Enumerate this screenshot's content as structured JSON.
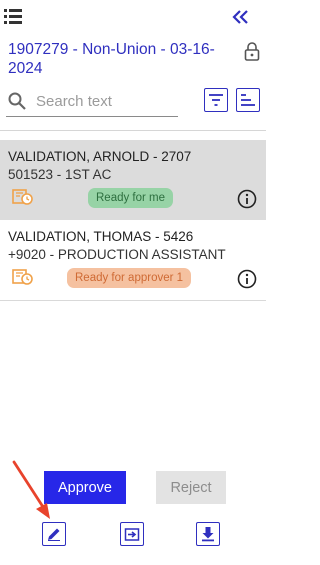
{
  "header": {
    "menu_icon": "menu-list-icon",
    "collapse_icon": "double-chevron-left-icon",
    "title": "1907279 - Non-Union - 03-16-2024",
    "lock_icon": "lock-icon"
  },
  "search": {
    "placeholder": "Search text",
    "value": ""
  },
  "toolbar": {
    "filter_icon": "filter-icon",
    "sort_icon": "sort-icon"
  },
  "rows": [
    {
      "name": "VALIDATION, ARNOLD - 2707",
      "position": "501523 - 1ST AC",
      "status": "Ready for me",
      "selected": true
    },
    {
      "name": "VALIDATION, THOMAS - 5426",
      "position": "+9020 - PRODUCTION ASSISTANT",
      "status": "Ready for approver 1",
      "selected": false
    }
  ],
  "actions": {
    "approve_label": "Approve",
    "reject_label": "Reject",
    "edit_icon": "edit-pencil-icon",
    "move_icon": "move-to-icon",
    "download_icon": "download-icon"
  },
  "colors": {
    "accent": "#2727e8",
    "link": "#2f2fbf",
    "status_ready_bg": "#97d3a6",
    "status_pending_bg": "#f5c1a0",
    "annotation_arrow": "#e8432c"
  }
}
